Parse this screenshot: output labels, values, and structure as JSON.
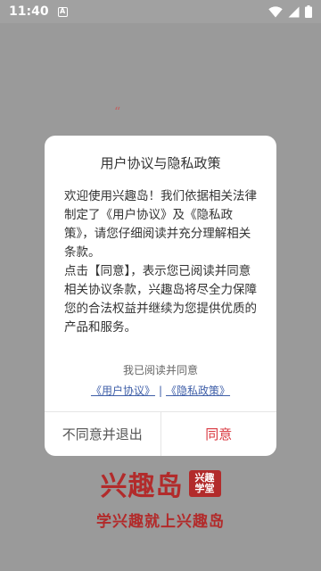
{
  "status_bar": {
    "time": "11:40",
    "notification_icon": "A",
    "icons": [
      "wifi-icon",
      "signal-icon",
      "battery-icon"
    ]
  },
  "splash": {
    "quote_mark": "“"
  },
  "dialog": {
    "title": "用户协议与隐私政策",
    "paragraph1": "欢迎使用兴趣岛！我们依据相关法律制定了《用户协议》及《隐私政策》，请您仔细阅读并充分理解相关条款。",
    "paragraph2": "点击【同意】，表示您已阅读并同意相关协议条款，兴趣岛将尽全力保障您的合法权益并继续为您提供优质的产品和服务。",
    "agree_read": "我已阅读并同意",
    "link_user_agreement": "《用户协议》",
    "link_separator": "|",
    "link_privacy_policy": "《隐私政策》",
    "decline_label": "不同意并退出",
    "agree_label": "同意"
  },
  "brand": {
    "name": "兴趣岛",
    "badge_line1": "兴趣",
    "badge_line2": "学堂",
    "slogan": "学兴趣就上兴趣岛"
  },
  "colors": {
    "accent": "#d9363e",
    "brand": "#b22b2b",
    "link": "#3f5fa8"
  }
}
